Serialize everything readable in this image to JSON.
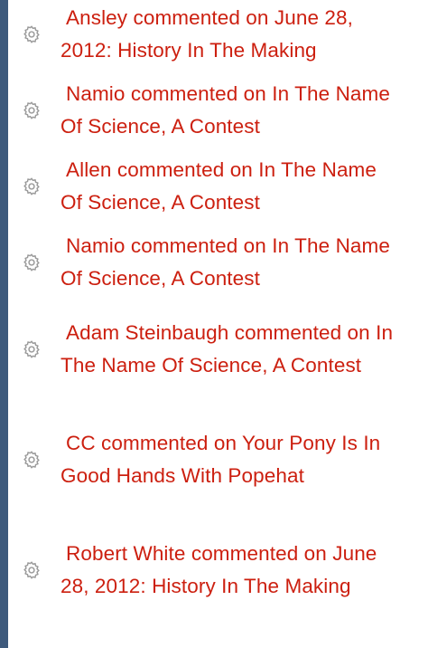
{
  "sidebar_color": "#3e5a7c",
  "link_color": "#cc1f0f",
  "icon": "cog-icon",
  "recent_comments": [
    {
      "text": "Ansley commented on June 28, 2012: History In The Making"
    },
    {
      "text": "Namio commented on In The Name Of Science, A Contest"
    },
    {
      "text": "Allen commented on In The Name Of Science, A Contest"
    },
    {
      "text": "Namio commented on In The Name Of Science, A Contest"
    },
    {
      "text": "Adam Steinbaugh commented on In The Name Of Science, A Contest"
    },
    {
      "text": "CC commented on Your Pony Is In Good Hands With Popehat"
    },
    {
      "text": "Robert White commented on June 28, 2012: History In The Making"
    }
  ]
}
